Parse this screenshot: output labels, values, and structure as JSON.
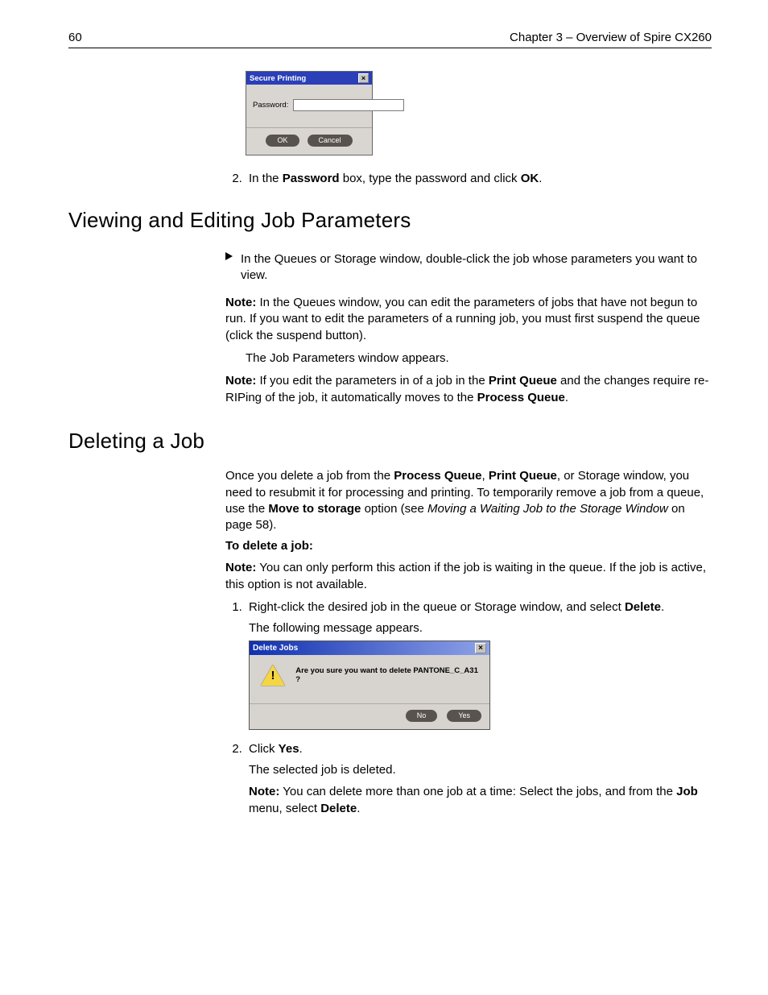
{
  "header": {
    "page_number": "60",
    "chapter": "Chapter 3 – Overview of Spire CX260"
  },
  "secure_dialog": {
    "title": "Secure Printing",
    "label": "Password:",
    "ok": "OK",
    "cancel": "Cancel",
    "value": ""
  },
  "step_password": {
    "pre": "In the ",
    "b1": "Password",
    "mid": " box, type the password and click ",
    "b2": "OK",
    "end": "."
  },
  "section1": {
    "heading": "Viewing and Editing Job Parameters",
    "bullet": "In the Queues or Storage window, double-click the job whose parameters you want to view.",
    "note1_label": "Note:",
    "note1_text": "  In the Queues window, you can edit the parameters of jobs that have not begun to run. If you want to edit the parameters of a running job, you must first suspend the queue (click the suspend button).",
    "after": "The Job Parameters window appears.",
    "note2_label": "Note:",
    "note2_pre": "  If you edit the parameters in of a job in the ",
    "note2_b1": "Print Queue",
    "note2_mid": " and the changes require re-RIPing of the job, it automatically moves to the ",
    "note2_b2": "Process Queue",
    "note2_end": "."
  },
  "section2": {
    "heading": "Deleting a Job",
    "p1_pre": "Once you delete a job from the ",
    "p1_b1": "Process Queue",
    "p1_sep": ", ",
    "p1_b2": "Print Queue",
    "p1_mid": ", or Storage window, you need to resubmit it for processing and printing. To temporarily remove a job from a queue, use the ",
    "p1_b3": "Move to storage",
    "p1_post": " option (see ",
    "p1_i": "Moving a Waiting Job to the Storage Window",
    "p1_end": " on page 58).",
    "sub": "To delete a job:",
    "note_label": "Note:",
    "note_text": "  You can only perform this action if the job is waiting in the queue. If the job is active, this option is not available.",
    "step1_pre": "Right-click the desired job in the queue or Storage window, and select ",
    "step1_b": "Delete",
    "step1_end": ".",
    "step1_after": "The following message appears.",
    "step2_pre": "Click ",
    "step2_b": "Yes",
    "step2_end": ".",
    "step2_after": "The selected job is deleted.",
    "note3_label": "Note:",
    "note3_pre": "  You can delete more than one job at a time: Select the jobs, and from the ",
    "note3_b1": "Job",
    "note3_mid": " menu, select ",
    "note3_b2": "Delete",
    "note3_end": "."
  },
  "delete_dialog": {
    "title": "Delete Jobs",
    "message": "Are you sure you want to delete PANTONE_C_A31 ?",
    "no": "No",
    "yes": "Yes",
    "warn": "!"
  }
}
